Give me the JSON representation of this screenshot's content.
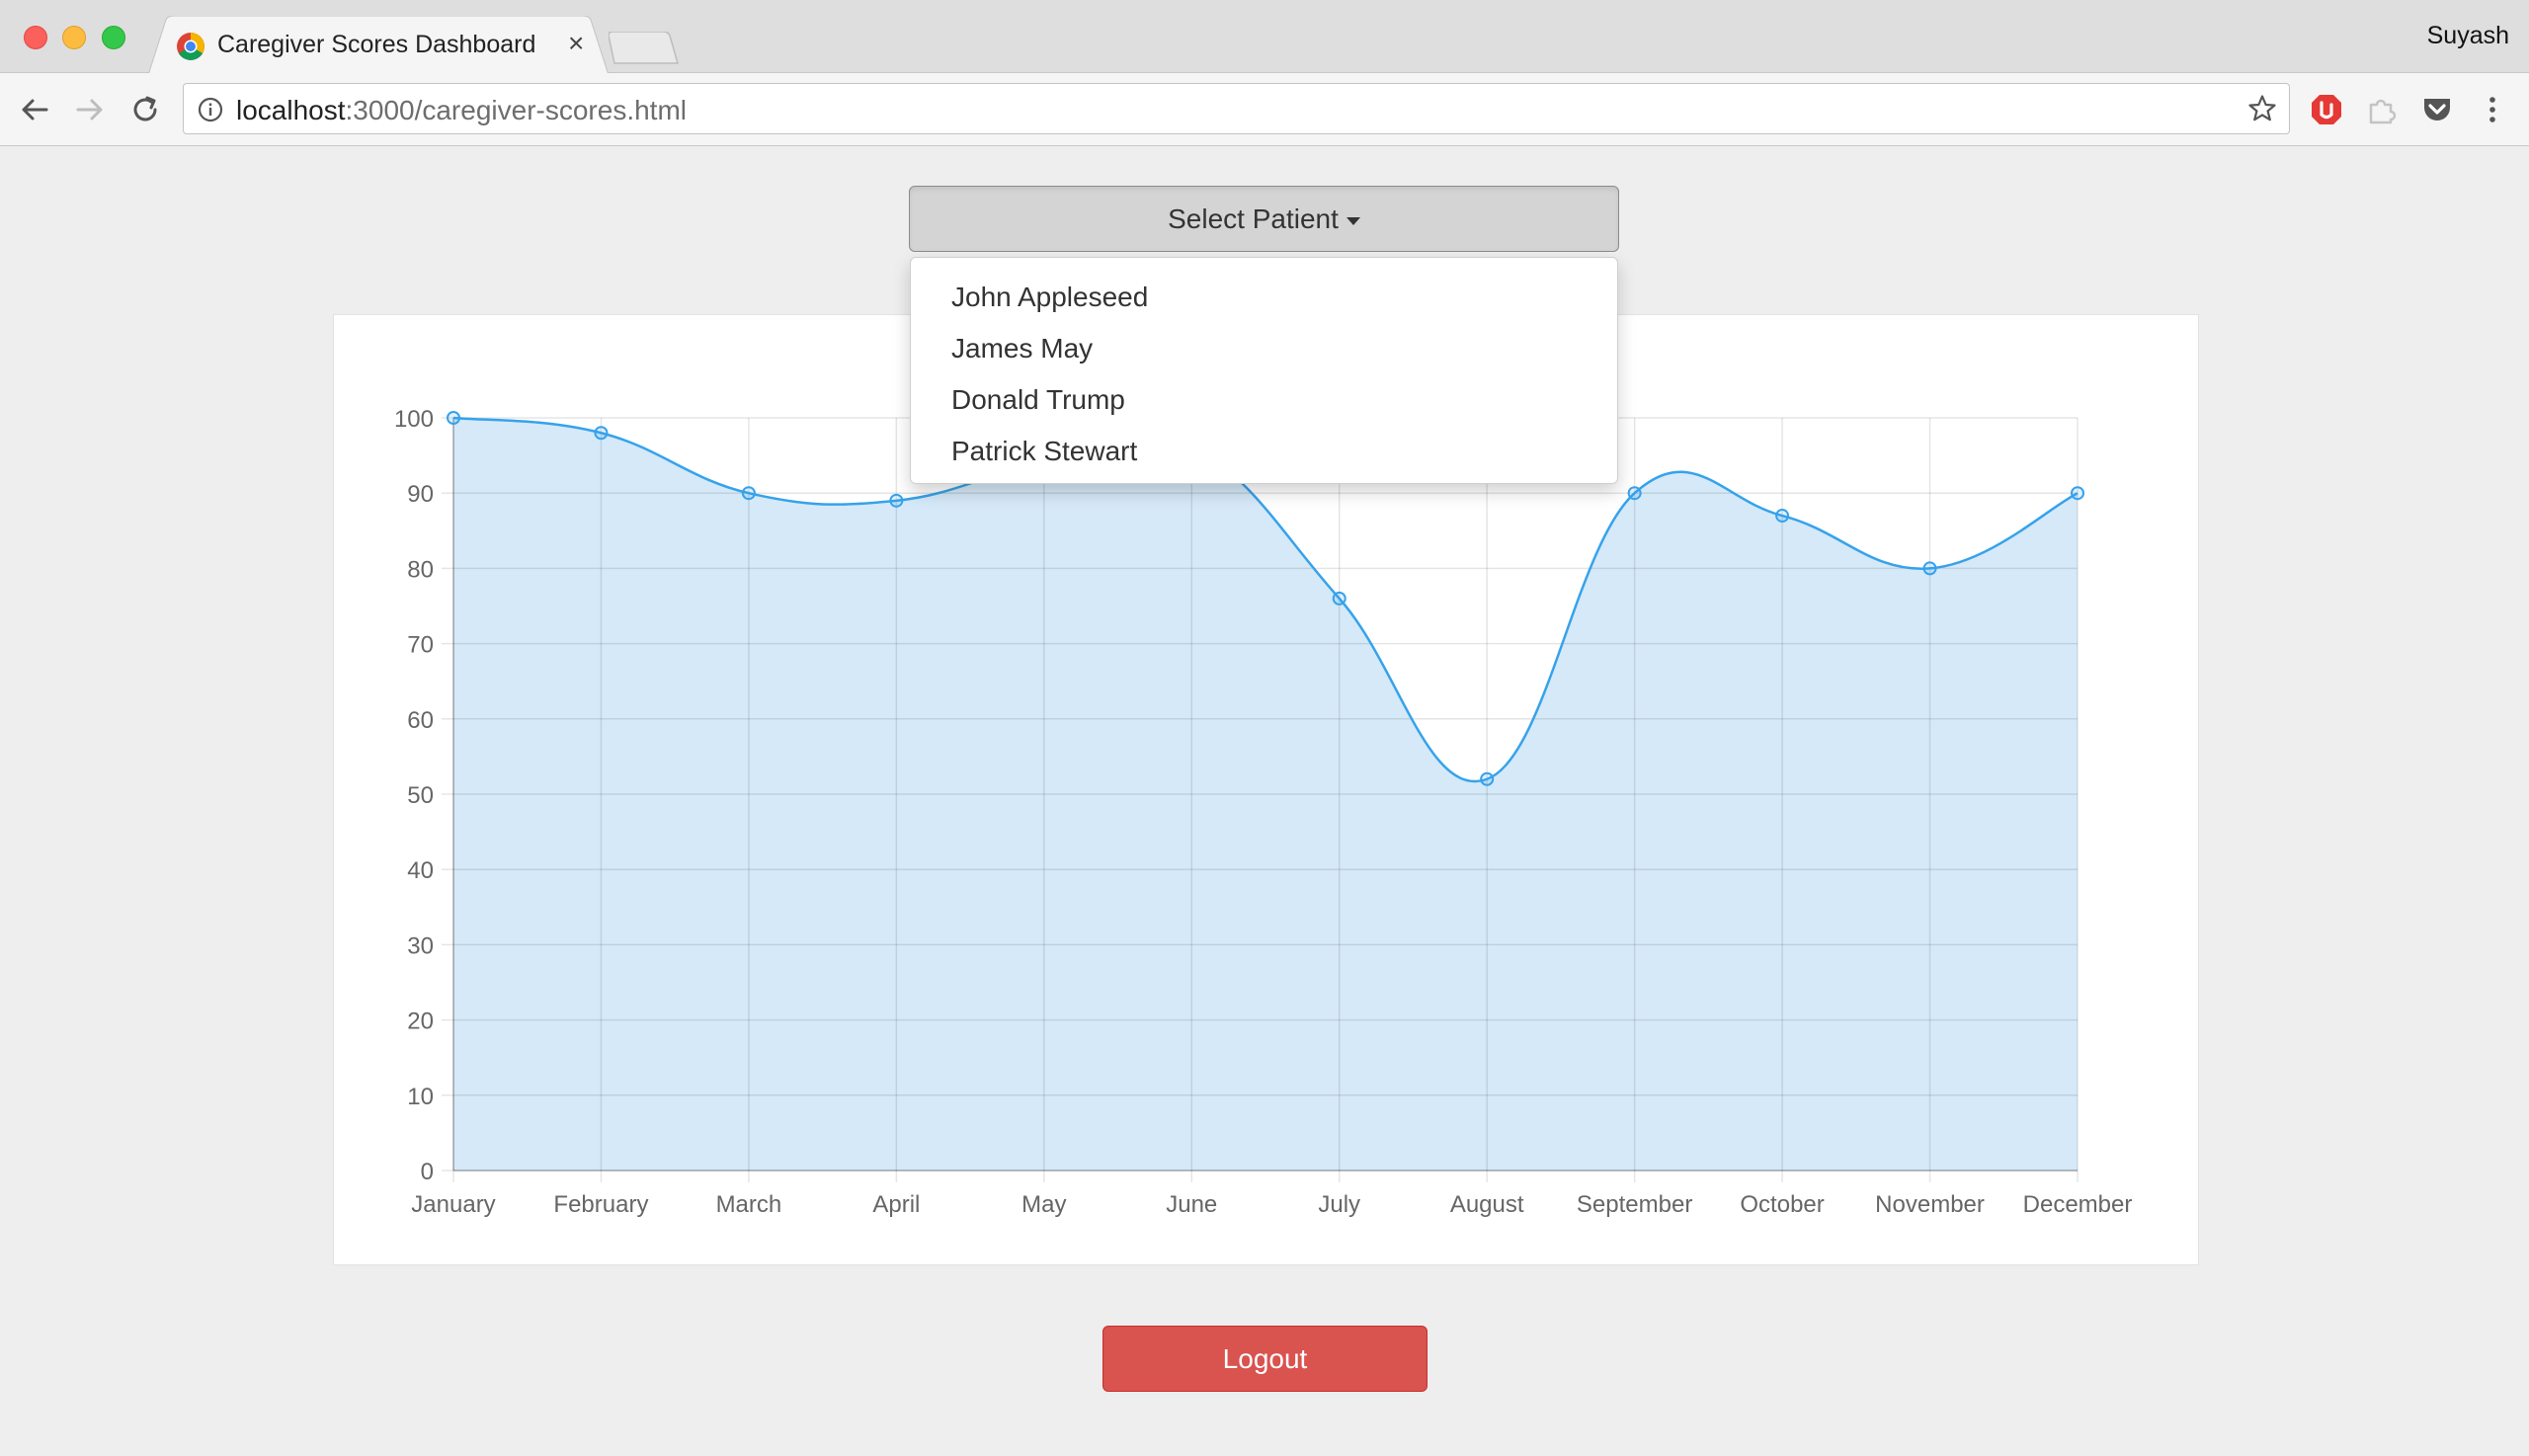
{
  "browser": {
    "tab_title": "Caregiver Scores Dashboard",
    "tab_close": "×",
    "profile_name": "Suyash",
    "url_host": "localhost",
    "url_path": ":3000/caregiver-scores.html",
    "colors": {
      "red": "#fc605c",
      "yellow": "#fdbc40",
      "green": "#34c84a"
    }
  },
  "page": {
    "select_label": "Select Patient",
    "patients": [
      "John Appleseed",
      "James May",
      "Donald Trump",
      "Patrick Stewart"
    ],
    "logout_label": "Logout",
    "colors": {
      "logout": "#d9534f",
      "line": "#36a2eb",
      "fill": "#d5e9f8"
    }
  },
  "chart_data": {
    "type": "area",
    "categories": [
      "January",
      "February",
      "March",
      "April",
      "May",
      "June",
      "July",
      "August",
      "September",
      "October",
      "November",
      "December"
    ],
    "series": [
      {
        "values": [
          100,
          98,
          90,
          89,
          94,
          96,
          76,
          52,
          90,
          87,
          80,
          90
        ]
      }
    ],
    "yticks": [
      0,
      10,
      20,
      30,
      40,
      50,
      60,
      70,
      80,
      90,
      100
    ],
    "ylim": [
      0,
      100
    ],
    "grid": true,
    "curve": "smooth"
  }
}
